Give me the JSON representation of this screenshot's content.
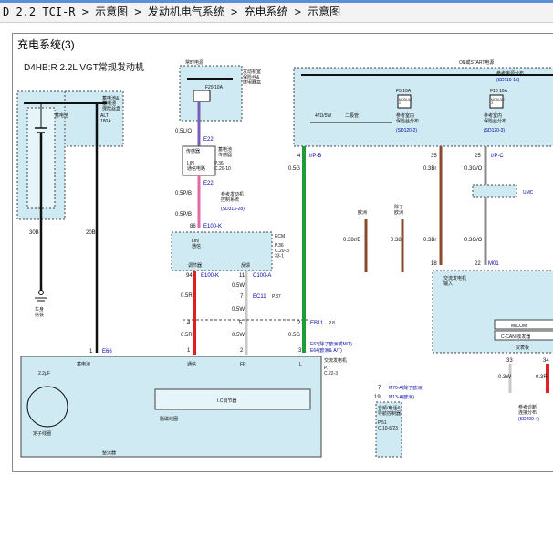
{
  "breadcrumb": "D 2.2 TCI-R > 示意图 > 发动机电气系统 > 充电系统 > 示意图",
  "panel_title": "充电系统(3)",
  "diagram": {
    "engine_label": "D4HB:R 2.2L VGT常规发动机",
    "always_live": "常时电源",
    "on_start": "ON或START电源",
    "battery_fuse_box": "蓄电池&\n蓄电池\n保险丝盒",
    "battery": "蓄电池",
    "alt_fuse": "ALT\n180A",
    "engine_room_fuse": "发动机室\n保险丝&\n继电器盒",
    "fuse_f29": "F29 10A",
    "fuse_f5": "F5 10A",
    "fuse_f10": "F10 10A",
    "module2": "MODULE\n2",
    "module3": "MODULE\n3",
    "power_dist": "参考电源分布",
    "power_ref": "(SD110-15)",
    "resistor": "47Ω/5W",
    "diode": "二极管",
    "indoor_fuse_a": "参考室内\n保险丝分布",
    "indoor_fuse_a_ref": "(SD120-2)",
    "indoor_fuse_b": "参考室内\n保险丝分布",
    "indoor_fuse_b_ref": "(SD120-3)",
    "sensor": "传感器",
    "battery_sensor": "蓄电池\n传感器",
    "p36_a": "P.36\nC.20-10",
    "lin_comm": "LIN\n通信电路",
    "engine_ctrl": "参考发动机\n控制系统",
    "engine_ctrl_ref": "(SD313-28)",
    "ecm": "ECM",
    "p36_b": "P.36\nC.20-2/\n33-1",
    "lin_comm2": "LIN\n通信",
    "regulation": "调节器",
    "feedback": "反馈",
    "ec11": "EC11",
    "p37": "P.37",
    "eb11": "EB11",
    "p8": "P.8",
    "e63": "E63(除了欧洲或M/T)",
    "e64": "E64(欧洲& A/T)",
    "alternator": "交流发电机",
    "p7": "P.7\nC.22-3",
    "comm": "通信",
    "fr": "FR",
    "l": "L",
    "ic_reg": "I.C调节器",
    "excitation": "励磁线圈",
    "stator": "定子线圈",
    "rectifier": "整流器",
    "cap": "2.2µF",
    "chassis": "车身\n搭铁",
    "europe": "欧洲",
    "not_europe": "除了\n欧洲",
    "alt_input": "交流发电机\n输入",
    "micom": "MICOM",
    "ccan": "C-CAN 收发器",
    "meter": "仪表板",
    "diag": "参考诊断\n连接分布",
    "diag_ref": "(SD200-4)",
    "umc": "UMC",
    "m70": "M70-A(除了欧洲)",
    "m13": "M13-A(欧洲)",
    "meter_ctrl": "音频/电话&\n导航控制器",
    "p51": "P.51\nC.10-8/23",
    "connectors": {
      "e22a": "E22",
      "e22b": "E22",
      "e100k_a": "E100-K",
      "e100k_b": "E100-K",
      "c100a": "C100-A",
      "e66": "E66",
      "ipb": "I/P-B",
      "ipc": "I/P-C",
      "m01": "M01"
    },
    "wires": {
      "w05io": "0.5L/O",
      "w05pb_a": "0.5P/B",
      "w05pb_b": "0.5P/B",
      "w05pb_c": "0.5P/B",
      "w05r_a": "0.5R",
      "w05r_b": "0.5R",
      "w05w_a": "0.5W",
      "w05w_b": "0.5W",
      "w05w_c": "0.5W",
      "w05g_a": "0.5G",
      "w05g_b": "0.5G",
      "w30b": "30B",
      "w20b": "20B",
      "w038rb": "0.38r/B",
      "w038r_a": "0.38r",
      "w038r_b": "0.3Br",
      "w038r_c": "0.3Br",
      "w03gio_a": "0.3G/O",
      "w03gio_b": "0.3G/O",
      "w03w": "0.3W",
      "w03r": "0.3R"
    },
    "pins": {
      "p86": "86",
      "p94": "94",
      "p11": "11",
      "p7": "7",
      "p1a": "1",
      "p4a": "4",
      "p5a": "5",
      "p2a": "2",
      "p4b": "4",
      "p35": "35",
      "p25": "25",
      "p18": "18",
      "p22": "22",
      "p33": "33",
      "p34": "34",
      "p7b": "7",
      "p19": "19",
      "p1": "1",
      "p2": "2",
      "p3": "3",
      "p1e": "1",
      "p1f": "1"
    }
  }
}
